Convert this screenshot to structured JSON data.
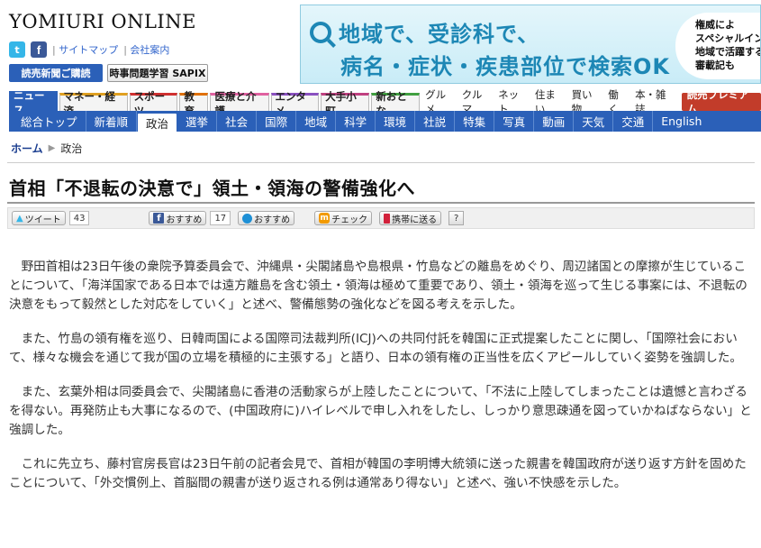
{
  "header": {
    "logo": "YOMIURI ONLINE",
    "social_links": [
      "サイトマップ",
      "会社案内"
    ],
    "subscribe_label": "読売新聞ご購読",
    "sapix_label": "時事問題学習 SAPIX"
  },
  "ad": {
    "line1": "地域で、受診科で、",
    "line2": "病名・症状・疾患部位で検索OK",
    "side_lines": [
      "権威によ",
      "スペシャルインタ",
      "地域で活躍する",
      "審載記も"
    ]
  },
  "genre_tabs": [
    "ニュース",
    "マネー・経済",
    "スポーツ",
    "教育",
    "医療と介護",
    "エンタメ",
    "大手小町",
    "新おとな"
  ],
  "genre_links": [
    "グルメ",
    "クルマ",
    "ネット",
    "住まい",
    "買い物",
    "働く",
    "本・雑誌"
  ],
  "premium_label": "読売プレミアム",
  "sections": [
    "総合トップ",
    "新着順",
    "政治",
    "選挙",
    "社会",
    "国際",
    "地域",
    "科学",
    "環境",
    "社説",
    "特集",
    "写真",
    "動画",
    "天気",
    "交通",
    "English"
  ],
  "active_section": "政治",
  "breadcrumb": {
    "home": "ホーム",
    "current": "政治"
  },
  "headline": "首相「不退転の決意で」領土・領海の警備強化へ",
  "share": {
    "tweet_label": "ツイート",
    "tweet_count": "43",
    "fb_label": "おすすめ",
    "fb_count": "17",
    "hatena_label": "おすすめ",
    "mixi_label": "チェック",
    "mobile_label": "携帯に送る",
    "help_label": "?"
  },
  "article": {
    "paragraphs": [
      "野田首相は23日午後の衆院予算委員会で、沖縄県・尖閣諸島や島根県・竹島などの離島をめぐり、周辺諸国との摩擦が生じていることについて、「海洋国家である日本では遠方離島を含む領土・領海は極めて重要であり、領土・領海を巡って生じる事案には、不退転の決意をもって毅然とした対応をしていく」と述べ、警備態勢の強化などを図る考えを示した。",
      "また、竹島の領有権を巡り、日韓両国による国際司法裁判所(ICJ)への共同付託を韓国に正式提案したことに関し、「国際社会において、様々な機会を通じて我が国の立場を積極的に主張する」と語り、日本の領有権の正当性を広くアピールしていく姿勢を強調した。",
      "また、玄葉外相は同委員会で、尖閣諸島に香港の活動家らが上陸したことについて、「不法に上陸してしまったことは遺憾と言わざるを得ない。再発防止も大事になるので、(中国政府に)ハイレベルで申し入れをしたし、しっかり意思疎通を図っていかねばならない」と強調した。",
      "これに先立ち、藤村官房長官は23日午前の記者会見で、首相が韓国の李明博大統領に送った親書を韓国政府が送り返す方針を固めたことについて、「外交慣例上、首脳間の親書が送り返される例は通常あり得ない」と述べ、強い不快感を示した。"
    ]
  },
  "colors": {
    "nav_blue": "#2b60b8",
    "premium_red": "#c23c2a",
    "ad_blue": "#1d87b5"
  }
}
